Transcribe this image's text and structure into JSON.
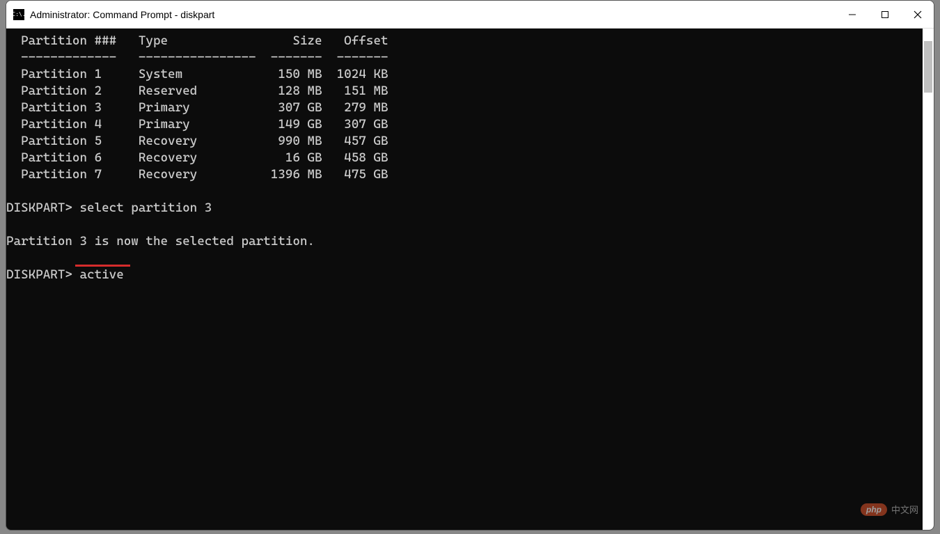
{
  "window": {
    "title": "Administrator: Command Prompt - diskpart",
    "icon_label": "C:\\."
  },
  "table": {
    "header": {
      "partition": "  Partition ###",
      "type": "Type",
      "size": "Size",
      "offset": "Offset"
    },
    "divider": {
      "partition": "  -------------",
      "type": "----------------",
      "size": "-------",
      "offset": "-------"
    },
    "rows": [
      {
        "partition": "  Partition 1",
        "type": "System",
        "size": "150 MB",
        "offset": "1024 KB"
      },
      {
        "partition": "  Partition 2",
        "type": "Reserved",
        "size": "128 MB",
        "offset": "151 MB"
      },
      {
        "partition": "  Partition 3",
        "type": "Primary",
        "size": "307 GB",
        "offset": "279 MB"
      },
      {
        "partition": "  Partition 4",
        "type": "Primary",
        "size": "149 GB",
        "offset": "307 GB"
      },
      {
        "partition": "  Partition 5",
        "type": "Recovery",
        "size": "990 MB",
        "offset": "457 GB"
      },
      {
        "partition": "  Partition 6",
        "type": "Recovery",
        "size": "16 GB",
        "offset": "458 GB"
      },
      {
        "partition": "  Partition 7",
        "type": "Recovery",
        "size": "1396 MB",
        "offset": "475 GB"
      }
    ]
  },
  "lines": {
    "cmd1_prompt": "DISKPART> ",
    "cmd1_text": "select partition 3",
    "response1": "Partition 3 is now the selected partition.",
    "cmd2_prompt": "DISKPART> ",
    "cmd2_text": "active"
  },
  "watermark": {
    "badge": "php",
    "text": "中文网"
  },
  "annotation": {
    "underline_color": "#d62c2c"
  }
}
